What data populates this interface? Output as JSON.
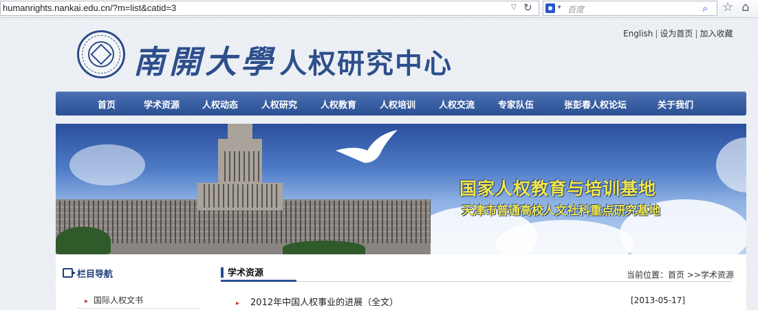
{
  "browser": {
    "url": "humanrights.nankai.edu.cn/?m=list&catid=3",
    "search_placeholder": "百度"
  },
  "header": {
    "toplinks": [
      "English",
      "设为首页",
      "加入收藏"
    ],
    "logo_text_calligraphy": "南開大學",
    "logo_text_center": "人权研究中心"
  },
  "nav": {
    "items": [
      "首页",
      "学术资源",
      "人权动态",
      "人权研究",
      "人权教育",
      "人权培训",
      "人权交流",
      "专家队伍",
      "张彭春人权论坛",
      "关于我们"
    ]
  },
  "banner": {
    "title": "国家人权教育与培训基地",
    "subtitle": "天津市普通高校人文社科重点研究基地"
  },
  "sidebar": {
    "heading": "栏目导航",
    "items": [
      "国际人权文书"
    ]
  },
  "main": {
    "section_title": "学术资源",
    "breadcrumb": "当前位置：首页 >>学术资源",
    "articles": [
      {
        "title": "2012年中国人权事业的进展（全文）",
        "date": "[2013-05-17]"
      }
    ]
  },
  "colors": {
    "nav_bg": "#2a4f92",
    "brand_blue": "#2d4f8c",
    "banner_text": "#f4e64a",
    "bullet_red": "#c0392b"
  }
}
